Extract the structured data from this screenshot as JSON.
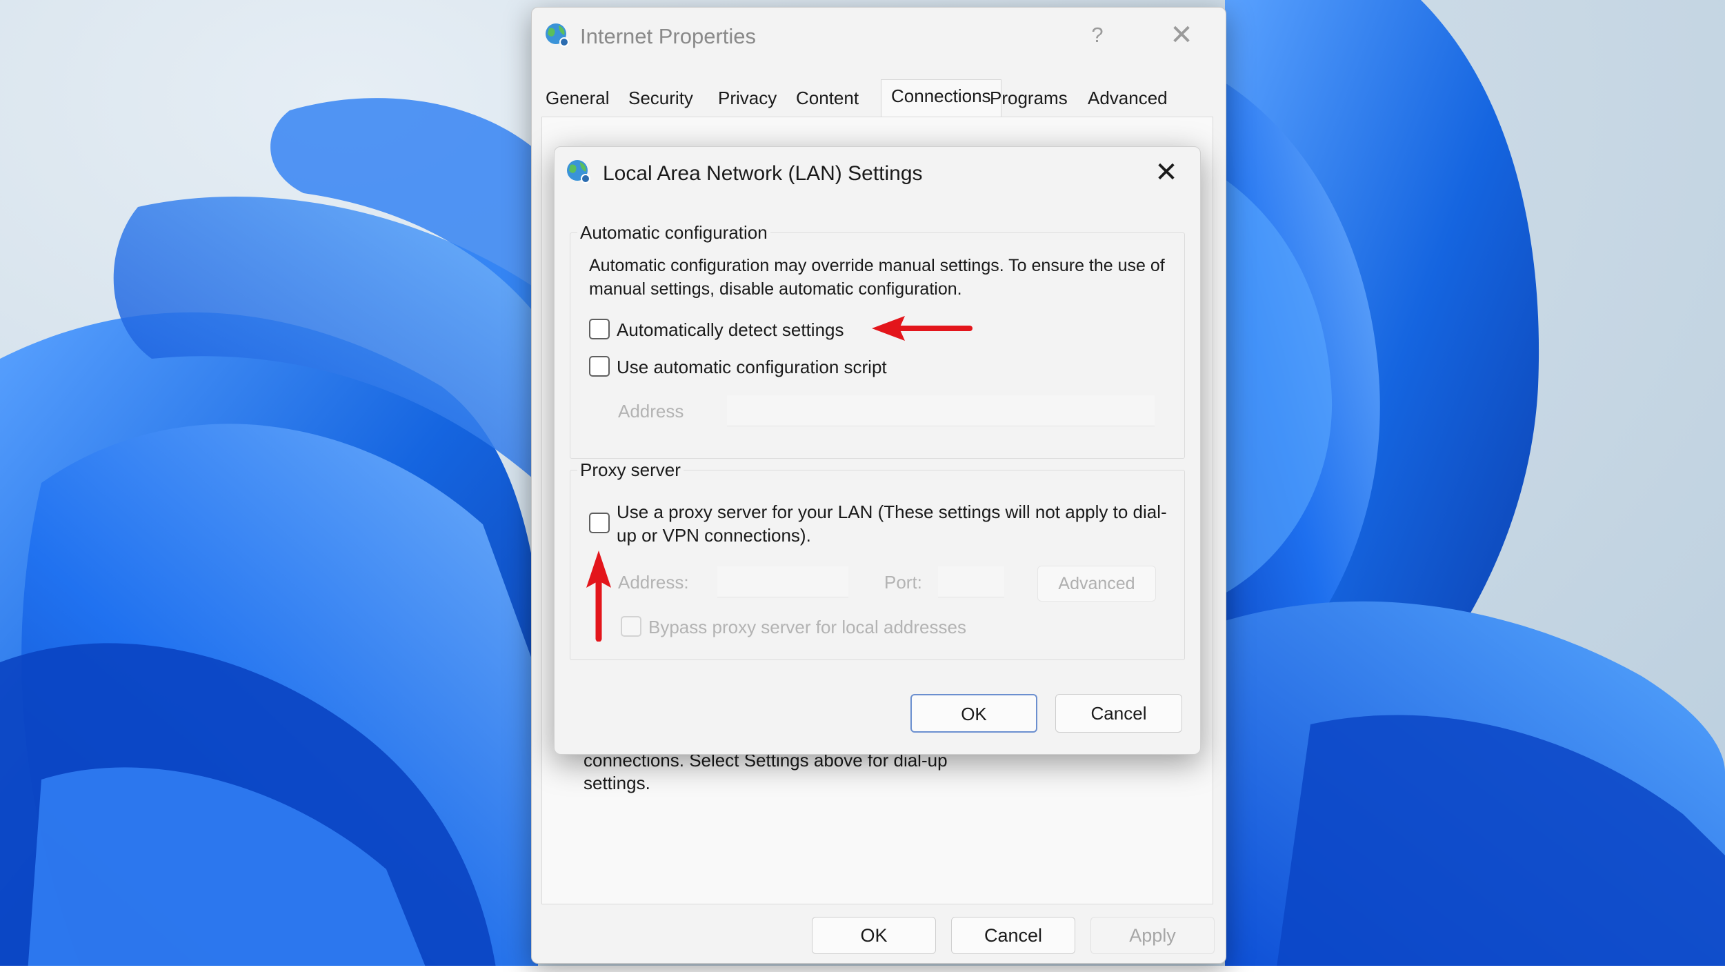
{
  "internet_properties": {
    "title": "Internet Properties",
    "help_glyph": "?",
    "close_glyph": "✕",
    "tabs": [
      {
        "label": "General"
      },
      {
        "label": "Security"
      },
      {
        "label": "Privacy"
      },
      {
        "label": "Content"
      },
      {
        "label": "Connections",
        "active": true
      },
      {
        "label": "Programs"
      },
      {
        "label": "Advanced"
      }
    ],
    "background_text": "connections. Select Settings above for dial-up settings.",
    "buttons": {
      "ok": "OK",
      "cancel": "Cancel",
      "apply": "Apply"
    }
  },
  "lan_dialog": {
    "title": "Local Area Network (LAN) Settings",
    "close_glyph": "✕",
    "automatic_configuration": {
      "legend": "Automatic configuration",
      "description": "Automatic configuration may override manual settings.  To ensure the use of manual settings, disable automatic configuration.",
      "auto_detect": {
        "label": "Automatically detect settings",
        "checked": false
      },
      "auto_script": {
        "label": "Use automatic configuration script",
        "checked": false
      },
      "address_label": "Address"
    },
    "proxy_server": {
      "legend": "Proxy server",
      "use_proxy": {
        "label": "Use a proxy server for your LAN (These settings will not apply to dial-up or VPN connections).",
        "checked": false
      },
      "address_label": "Address:",
      "port_label": "Port:",
      "advanced_button": "Advanced",
      "bypass": {
        "label": "Bypass proxy server for local addresses",
        "checked": false
      }
    },
    "buttons": {
      "ok": "OK",
      "cancel": "Cancel"
    }
  },
  "colors": {
    "annotation_arrow": "#e3151b",
    "wallpaper_blue": "#1565e0"
  },
  "icons": [
    "globe-icon",
    "help-icon",
    "close-icon",
    "annotation-arrow"
  ]
}
